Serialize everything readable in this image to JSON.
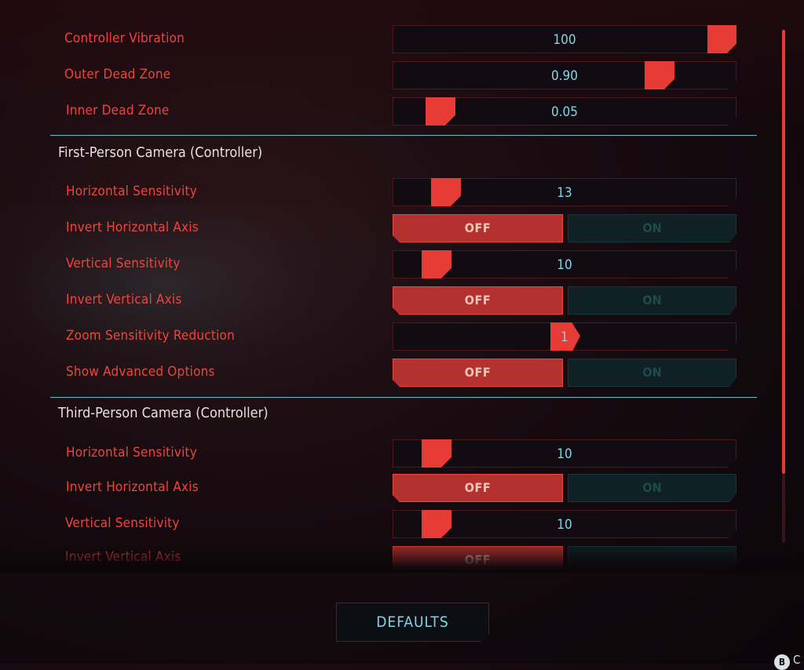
{
  "settings_top": {
    "controller_vibration": {
      "label": "Controller Vibration",
      "value": "100",
      "level": 1.0
    },
    "outer_dead_zone": {
      "label": "Outer Dead Zone",
      "value": "0.90",
      "level": 0.9
    },
    "inner_dead_zone": {
      "label": "Inner Dead Zone",
      "value": "0.05",
      "level": 0.05
    }
  },
  "first_person": {
    "title": "First-Person Camera (Controller)",
    "horizontal_sensitivity": {
      "label": "Horizontal Sensitivity",
      "value": "13"
    },
    "invert_horizontal": {
      "label": "Invert Horizontal Axis",
      "off": "OFF",
      "on": "ON"
    },
    "vertical_sensitivity": {
      "label": "Vertical Sensitivity",
      "value": "10"
    },
    "invert_vertical": {
      "label": "Invert Vertical Axis",
      "off": "OFF",
      "on": "ON"
    },
    "zoom_sensitivity_reduction": {
      "label": "Zoom Sensitivity Reduction",
      "value": "1"
    },
    "show_advanced": {
      "label": "Show Advanced Options",
      "off": "OFF",
      "on": "ON"
    }
  },
  "third_person": {
    "title": "Third-Person Camera (Controller)",
    "horizontal_sensitivity": {
      "label": "Horizontal Sensitivity",
      "value": "10"
    },
    "invert_horizontal": {
      "label": "Invert Horizontal Axis",
      "off": "OFF",
      "on": "ON"
    },
    "vertical_sensitivity": {
      "label": "Vertical Sensitivity",
      "value": "10"
    },
    "invert_vertical": {
      "label": "Invert Vertical Axis",
      "off": "OFF"
    }
  },
  "footer": {
    "defaults_label": "DEFAULTS",
    "b_button": "B",
    "b_label": "C"
  },
  "colors": {
    "accent_red": "#e63c35",
    "value_cyan": "#7fd6e6",
    "section_line": "#56c2cc"
  }
}
